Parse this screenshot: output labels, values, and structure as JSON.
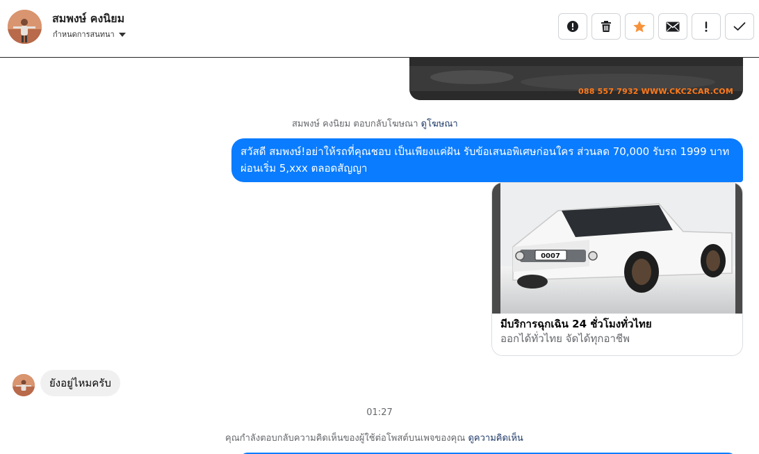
{
  "header": {
    "name": "สมพงษ์ คงนิยม",
    "subtitle": "กำหนดการสนทนา",
    "actions": [
      {
        "name": "spam-button",
        "icon": "alert-circle-icon"
      },
      {
        "name": "delete-button",
        "icon": "trash-icon"
      },
      {
        "name": "star-button",
        "icon": "star-icon"
      },
      {
        "name": "mark-unread-button",
        "icon": "envelope-icon"
      },
      {
        "name": "follow-up-button",
        "icon": "exclamation-icon"
      },
      {
        "name": "mark-done-button",
        "icon": "checkmark-icon"
      }
    ]
  },
  "thread": {
    "previous_watermark": "088 557 7932 WWW.CKC2CAR.COM",
    "ad_reply_meta": {
      "text": "สมพงษ์ คงนิยม ตอบกลับโฆษณา",
      "link": "ดูโฆษณา"
    },
    "outgoing_message": "สวัสดี สมพงษ์!อย่าให้รถที่คุณชอบ เป็นเพียงแค่ฝัน รับข้อเสนอพิเศษก่อนใคร ส่วนลด 70,000  รับรถ 1999 บาท ผ่อนเริ่ม 5,xxx ตลอดสัญญา",
    "card": {
      "plate": "0007",
      "title": "มีบริการฉุกเฉิน 24 ชั่วโมงทั่วไทย",
      "subtitle": "ออกได้ทั่วไทย จัดได้ทุกอาชีพ"
    },
    "incoming_message": "ยังอยู่ไหมครับ",
    "timestamp": "01:27",
    "comment_meta": {
      "text": "คุณกำลังตอบกลับความคิดเห็นของผู้ใช้ต่อโพสต์บนเพจของคุณ",
      "link": "ดูความคิดเห็น"
    }
  },
  "colors": {
    "accent": "#0a7cff",
    "star": "#f7923a",
    "link": "#1f3a68"
  }
}
